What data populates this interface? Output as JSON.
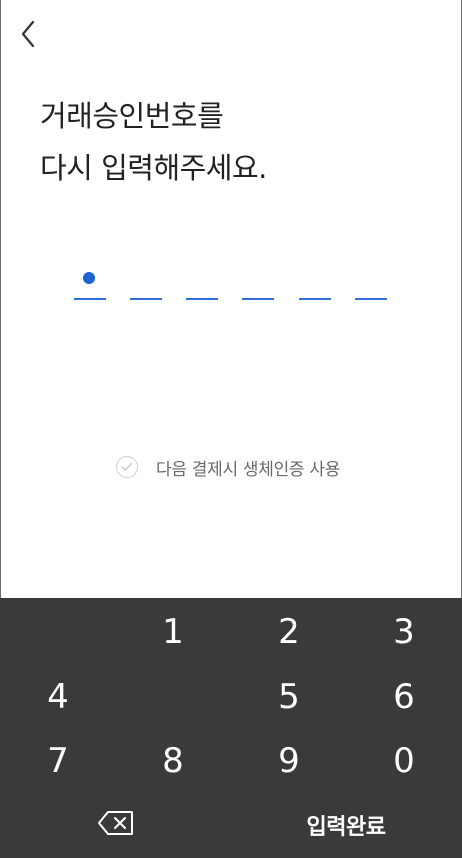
{
  "header": {
    "back_icon": "chevron-left-icon",
    "title_line1": "거래승인번호를",
    "title_line2": "다시 입력해주세요."
  },
  "pin": {
    "length": 6,
    "entered": 1,
    "accent_color": "#1f63d1"
  },
  "biometric": {
    "label": "다음 결제시 생체인증 사용",
    "checked": false,
    "icon": "check-circle-icon"
  },
  "keypad": {
    "background": "#3a3a3a",
    "rows": [
      [
        "",
        "1",
        "2",
        "3"
      ],
      [
        "4",
        "",
        "5",
        "6"
      ],
      [
        "7",
        "8",
        "9",
        "0"
      ]
    ],
    "backspace_icon": "backspace-icon",
    "submit_label": "입력완료"
  }
}
